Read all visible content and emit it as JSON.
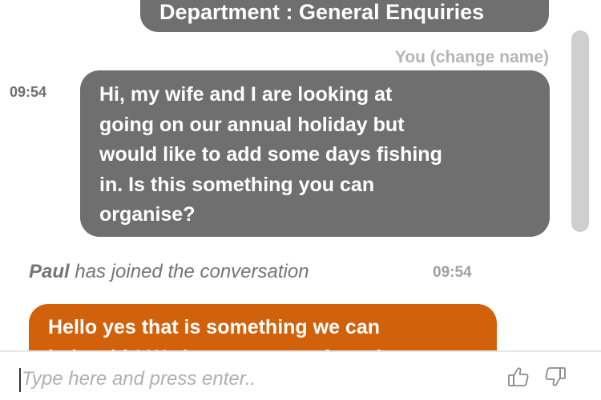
{
  "header": {
    "department_label": "Department : General Enquiries"
  },
  "messages": [
    {
      "sender": "You",
      "change_name_label": "(change name)",
      "time": "09:54",
      "lines": [
        "Hi, my wife and I are looking at",
        "going on our annual holiday but",
        "would like to add some days fishing",
        "in. Is this something you can",
        "organise?"
      ]
    },
    {
      "agent_name": "Paul",
      "event_text": "has joined the conversation",
      "time": "09:54"
    },
    {
      "lines": [
        "Hello yes that is something we can",
        "help with! We have a range of exotic locations"
      ]
    }
  ],
  "composer": {
    "placeholder": "Type here and press enter.."
  },
  "icons": {
    "rate_positive": "thumbs-up-icon",
    "rate_negative": "thumbs-down-icon"
  },
  "colors": {
    "user_bubble": "#6f6f6f",
    "agent_bubble": "#d2610c"
  }
}
